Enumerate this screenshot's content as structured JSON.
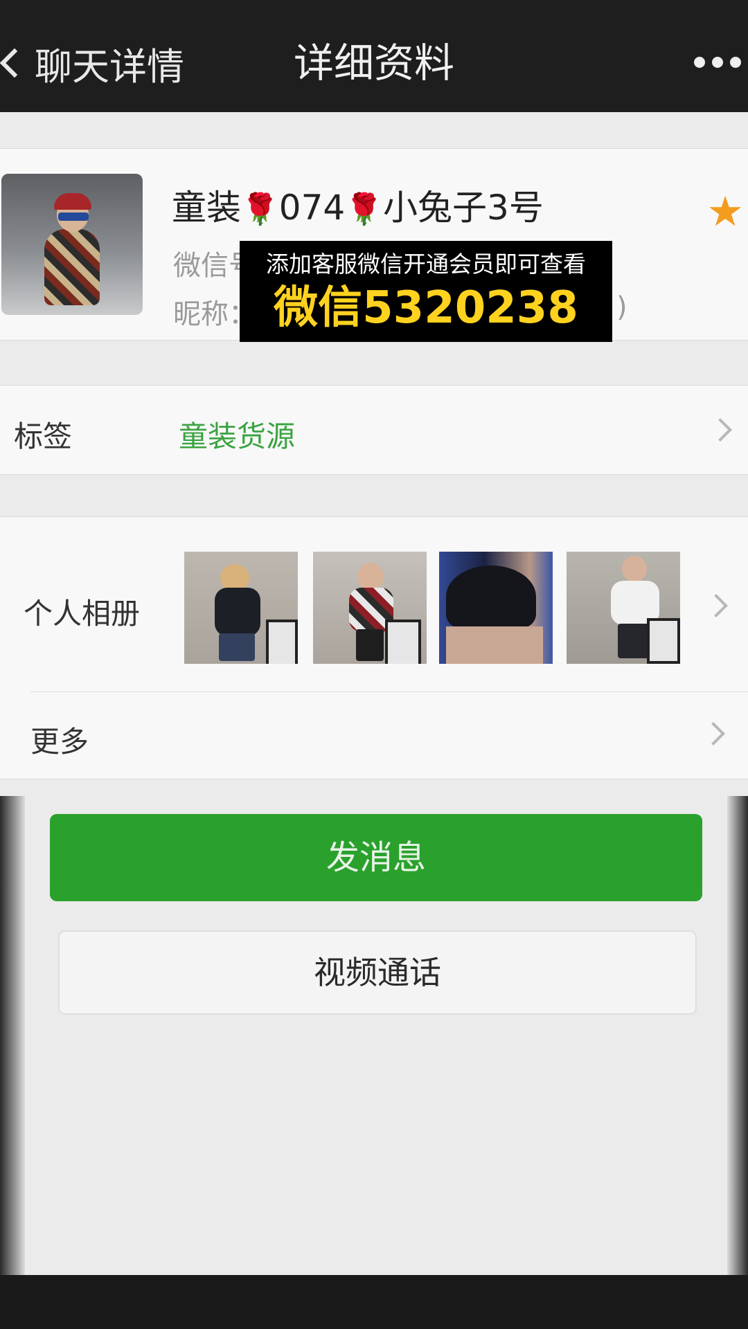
{
  "nav": {
    "back_label": "聊天详情",
    "title": "详细资料"
  },
  "profile": {
    "name_part1": "童装",
    "name_part2": "074",
    "name_part3": "小兔子3号",
    "wechat_label": "微信号",
    "nickname_label": "昵称：",
    "nickname_tail": ")",
    "starred": true
  },
  "promo": {
    "line1": "添加客服微信开通会员即可查看",
    "line2": "微信5320238"
  },
  "tag": {
    "label": "标签",
    "value": "童装货源"
  },
  "album": {
    "label": "个人相册",
    "photo_count": 4
  },
  "more": {
    "label": "更多"
  },
  "actions": {
    "send_label": "发消息",
    "video_label": "视频通话"
  },
  "colors": {
    "accent_green": "#2aa12c",
    "tag_green": "#3aa341",
    "star": "#f39c1e",
    "promo_yellow": "#ffd21f"
  }
}
